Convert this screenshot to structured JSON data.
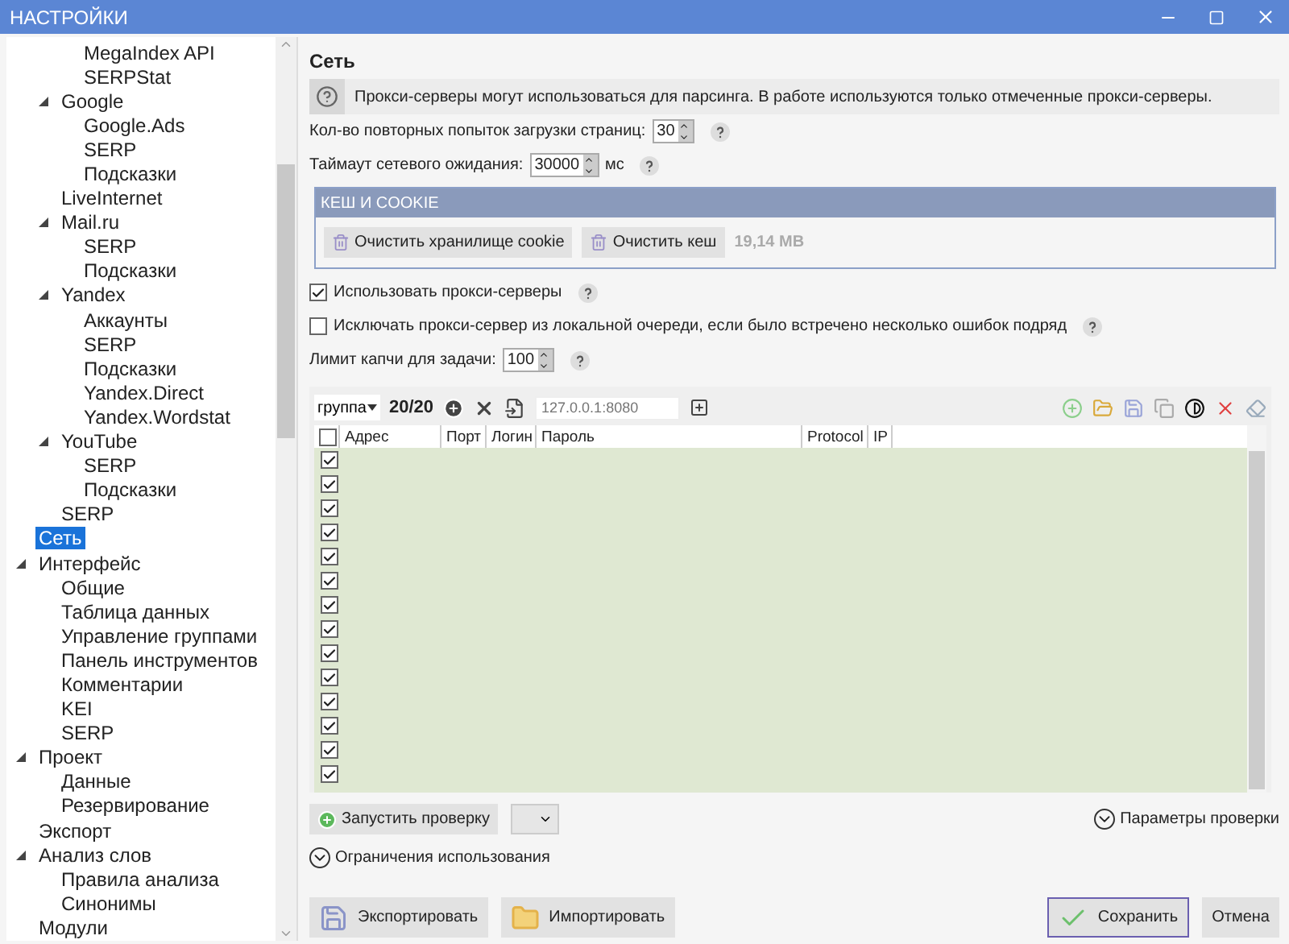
{
  "window": {
    "title": "НАСТРОЙКИ"
  },
  "sidebar": {
    "tree": [
      {
        "children": [
          {
            "children": [
              {
                "label": "MegaIndex API"
              },
              {
                "label": "SERPStat"
              }
            ]
          },
          {
            "label": "Google",
            "expanded": true,
            "children": [
              {
                "label": "Google.Ads"
              },
              {
                "label": "SERP"
              },
              {
                "label": "Подсказки"
              }
            ]
          },
          {
            "label": "LiveInternet"
          },
          {
            "label": "Mail.ru",
            "expanded": true,
            "children": [
              {
                "label": "SERP"
              },
              {
                "label": "Подсказки"
              }
            ]
          },
          {
            "label": "Yandex",
            "expanded": true,
            "children": [
              {
                "label": "Аккаунты"
              },
              {
                "label": "SERP"
              },
              {
                "label": "Подсказки"
              },
              {
                "label": "Yandex.Direct"
              },
              {
                "label": "Yandex.Wordstat"
              }
            ]
          },
          {
            "label": "YouTube",
            "expanded": true,
            "children": [
              {
                "label": "SERP"
              },
              {
                "label": "Подсказки"
              }
            ]
          },
          {
            "label": "SERP"
          }
        ]
      },
      {
        "label": "Сеть",
        "selected": true
      },
      {
        "label": "Интерфейс",
        "expanded": true,
        "children": [
          {
            "label": "Общие"
          },
          {
            "label": "Таблица данных"
          },
          {
            "label": "Управление группами"
          },
          {
            "label": "Панель инструментов"
          },
          {
            "label": "Комментарии"
          },
          {
            "label": "KEI"
          },
          {
            "label": "SERP"
          }
        ]
      },
      {
        "label": "Проект",
        "expanded": true,
        "children": [
          {
            "label": "Данные"
          },
          {
            "label": "Резервирование"
          }
        ]
      },
      {
        "label": "Экспорт"
      },
      {
        "label": "Анализ слов",
        "expanded": true,
        "children": [
          {
            "label": "Правила анализа"
          },
          {
            "label": "Синонимы"
          }
        ]
      },
      {
        "label": "Модули"
      }
    ]
  },
  "content": {
    "heading": "Сеть",
    "info": "Прокси-серверы могут использоваться для парсинга. В работе используются только отмеченные прокси-серверы.",
    "fields": [
      {
        "label": "Кол-во повторных попыток загрузки страниц:",
        "value": "30"
      },
      {
        "label": "Таймаут сетевого ожидания:",
        "value": "30000",
        "unit": "мс"
      }
    ],
    "cache": {
      "title": "КЕШ И COOKIE",
      "buttons": [
        "Очистить хранилище cookie",
        "Очистить кеш"
      ],
      "size": "19,14 MB"
    },
    "options": [
      {
        "kind": "checkbox",
        "label": "Использовать прокси-серверы",
        "checked": true
      },
      {
        "kind": "checkbox",
        "label": "Исключать прокси-сервер из локальной очереди, если было встречено несколько ошибок подряд",
        "checked": false
      },
      {
        "kind": "spinner",
        "label": "Лимит капчи для задачи:",
        "value": "100"
      }
    ],
    "proxy": {
      "group": "группа",
      "count": "20/20",
      "address_placeholder": "127.0.0.1:8080",
      "header_checked": false,
      "columns": [
        "Адрес",
        "Порт",
        "Логин",
        "Пароль",
        "Protocol",
        "IP"
      ],
      "rows": [
        {
          "checked": true
        },
        {
          "checked": true
        },
        {
          "checked": true
        },
        {
          "checked": true
        },
        {
          "checked": true
        },
        {
          "checked": true
        },
        {
          "checked": true
        },
        {
          "checked": true
        },
        {
          "checked": true
        },
        {
          "checked": true
        },
        {
          "checked": true
        },
        {
          "checked": true
        },
        {
          "checked": true
        },
        {
          "checked": true
        }
      ]
    },
    "check_button": "Запустить проверку",
    "check_params": "Параметры проверки",
    "limits": "Ограничения использования"
  },
  "footer": {
    "export": "Экспортировать",
    "import": "Импортировать",
    "save": "Сохранить",
    "cancel": "Отмена"
  }
}
